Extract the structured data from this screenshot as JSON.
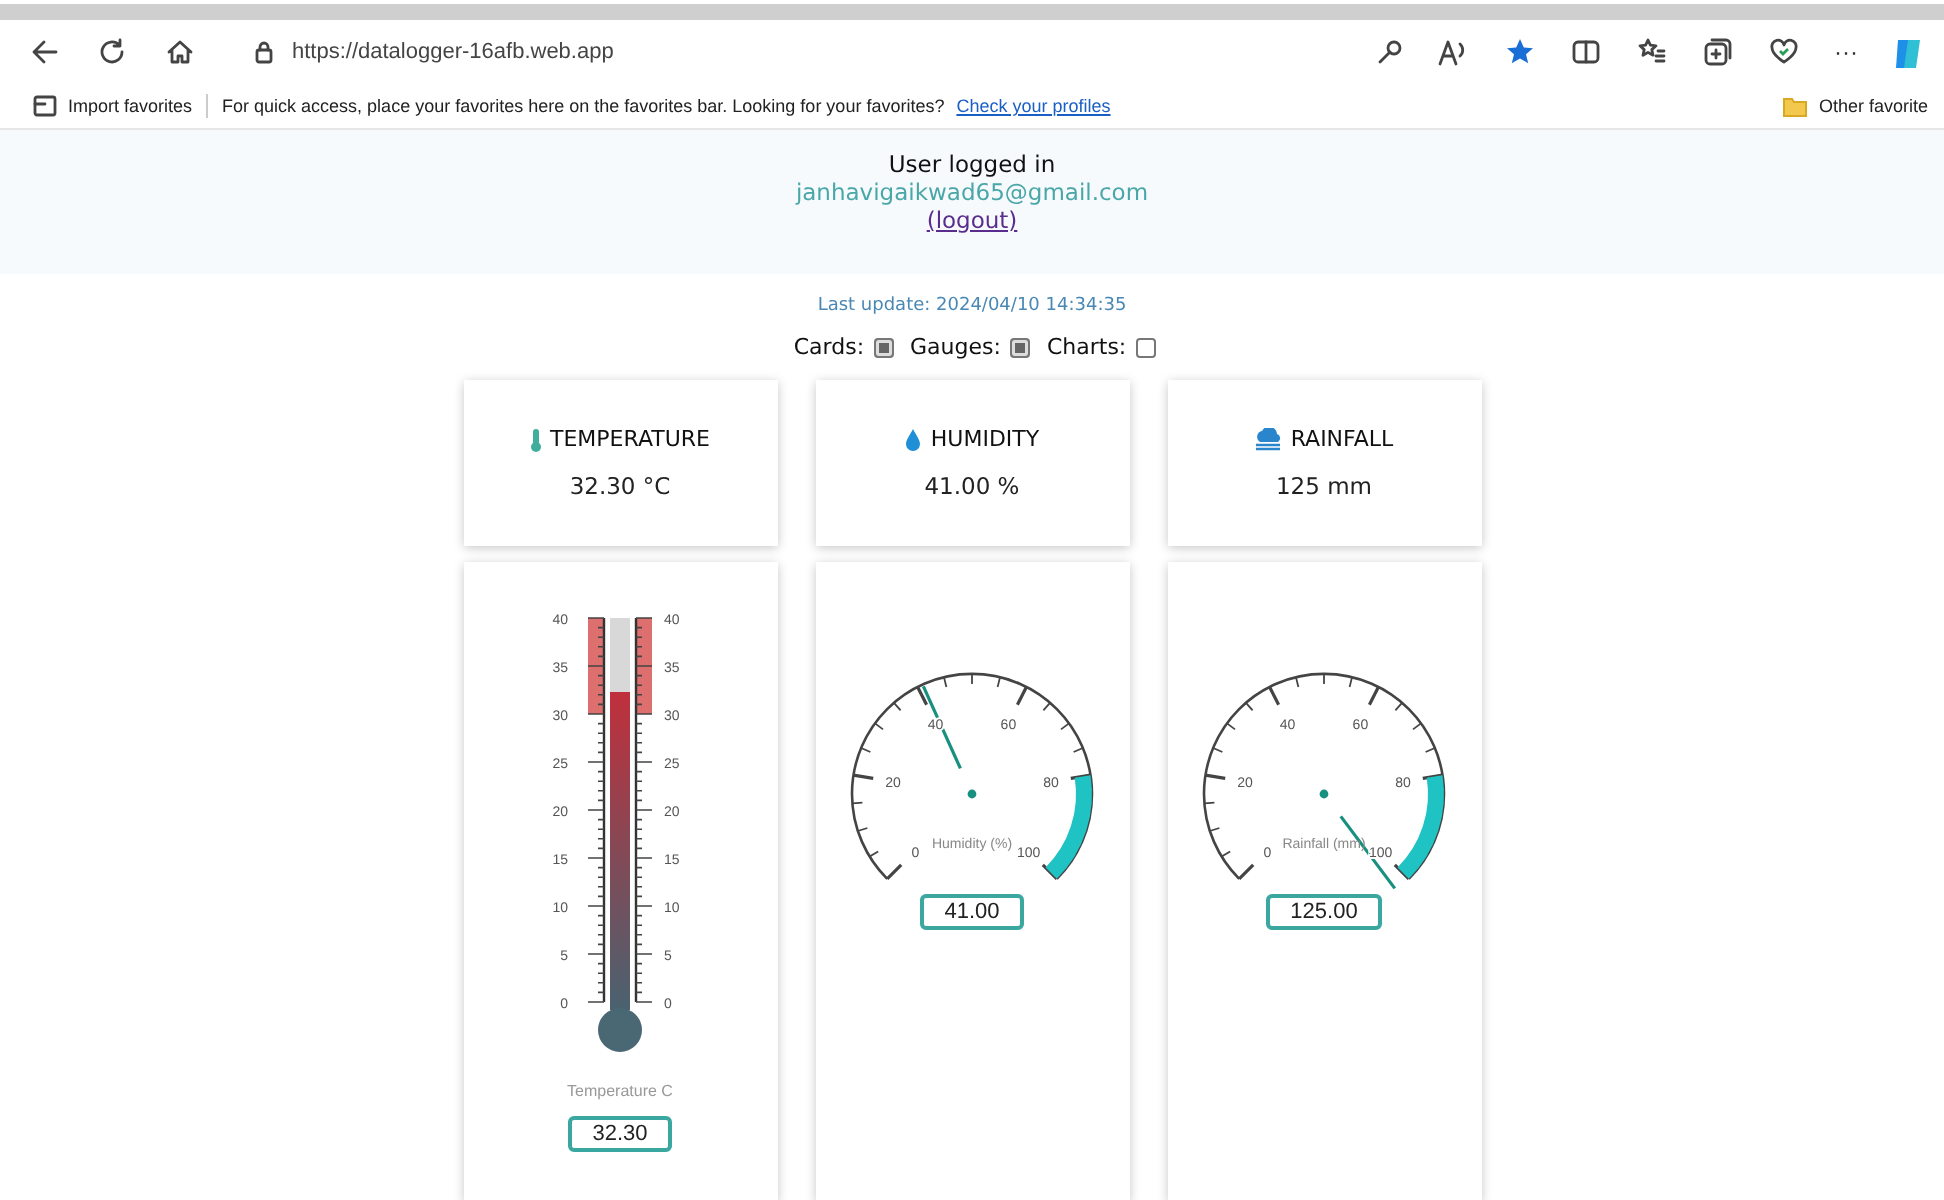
{
  "browser": {
    "url": "https://datalogger-16afb.web.app",
    "more": "···",
    "favorites_bar": {
      "import": "Import favorites",
      "message": "For quick access, place your favorites here on the favorites bar. Looking for your favorites?",
      "link": "Check your profiles",
      "other": "Other favorite"
    }
  },
  "user": {
    "heading": "User logged in",
    "email": "janhavigaikwad65@gmail.com",
    "logout": "(logout)"
  },
  "last_update": "Last update: 2024/04/10 14:34:35",
  "toggles": [
    {
      "label": "Cards:",
      "checked": true
    },
    {
      "label": "Gauges:",
      "checked": true
    },
    {
      "label": "Charts:",
      "checked": false
    }
  ],
  "cards": [
    {
      "kind": "temperature",
      "title": "TEMPERATURE",
      "value": "32.30 °C"
    },
    {
      "kind": "humidity",
      "title": "HUMIDITY",
      "value": "41.00 %"
    },
    {
      "kind": "rainfall",
      "title": "RAINFALL",
      "value": "125 mm"
    }
  ],
  "gauges": [
    {
      "kind": "thermometer",
      "title": "Temperature C",
      "reading": "32.30",
      "left_ticks": [
        "40",
        "35",
        "30",
        "25",
        "20",
        "15",
        "10",
        "5",
        "0"
      ],
      "right_ticks": [
        "40",
        "35",
        "30",
        "25",
        "20",
        "15",
        "10",
        "5",
        "0"
      ]
    },
    {
      "kind": "dial",
      "title": "Humidity (%)",
      "reading": "41.00",
      "ticks": [
        "0",
        "20",
        "40",
        "60",
        "80",
        "100"
      ]
    },
    {
      "kind": "dial",
      "title": "Rainfall (mm)",
      "reading": "125.00",
      "ticks": [
        "0",
        "20",
        "40",
        "60",
        "80",
        "100"
      ]
    }
  ]
}
